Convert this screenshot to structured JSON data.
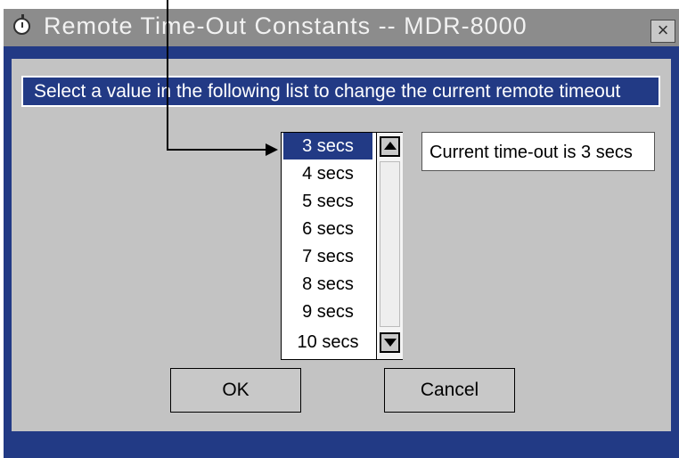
{
  "window": {
    "title": "Remote Time-Out Constants  --  MDR-8000",
    "close_glyph": "×"
  },
  "instruction": "Select a value in the following list to change the current remote timeout",
  "timeout_list": {
    "items": [
      "3 secs",
      "4 secs",
      "5 secs",
      "6 secs",
      "7 secs",
      "8 secs",
      "9 secs",
      "10 secs"
    ],
    "selected": "3 secs"
  },
  "current_timeout": "Current time-out is 3 secs",
  "buttons": {
    "ok": "OK",
    "cancel": "Cancel"
  },
  "colors": {
    "titlebar": "#8c8c8c",
    "frame": "#223a85",
    "panel": "#c3c3c3",
    "selection": "#223a85"
  }
}
